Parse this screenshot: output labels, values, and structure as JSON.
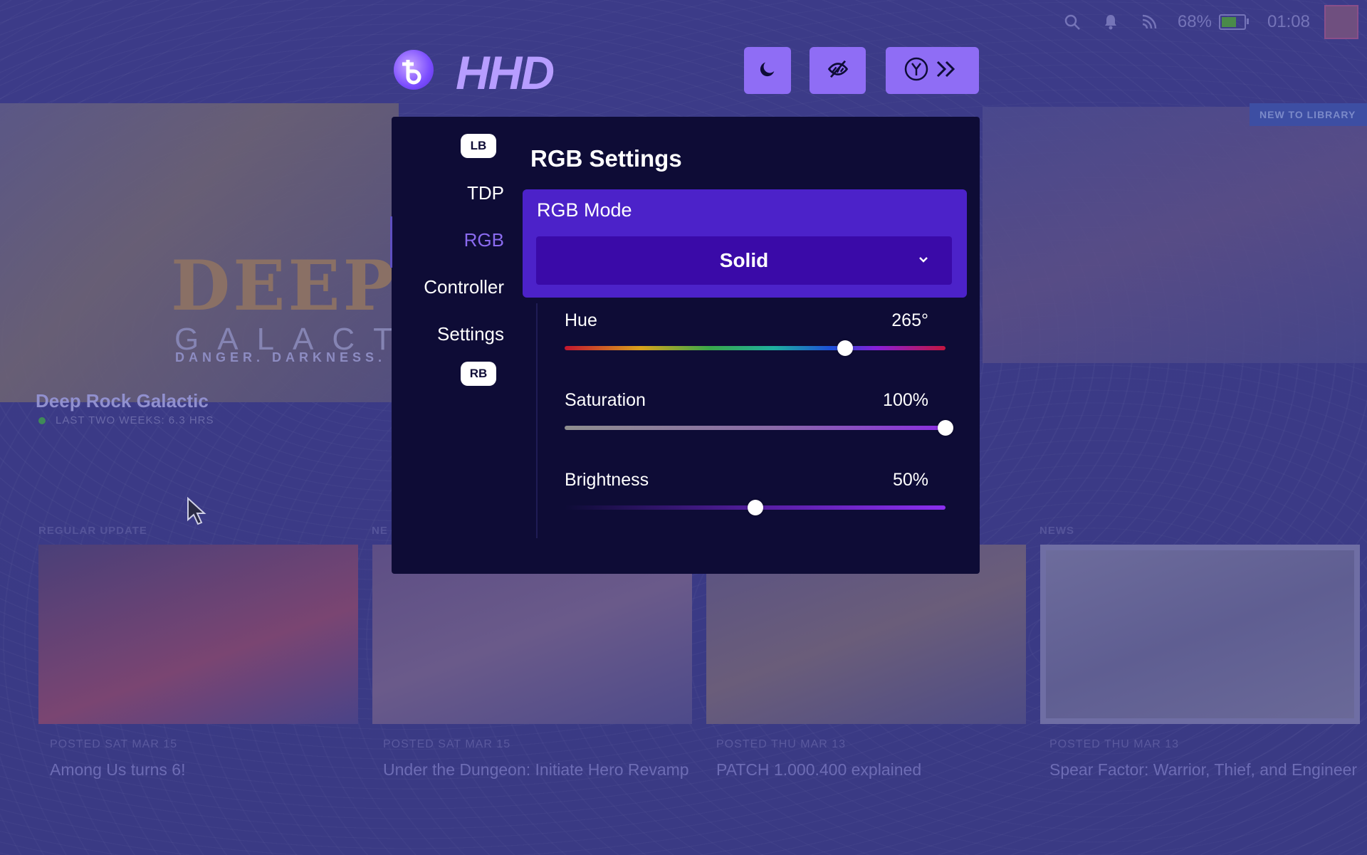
{
  "status_bar": {
    "battery_percent": "68%",
    "battery_level": 0.68,
    "time": "01:08",
    "icons": [
      "search-icon",
      "bell-icon",
      "wifi-icon",
      "battery-icon"
    ]
  },
  "top_bar": {
    "logo_text": "HHD",
    "buttons": [
      "moon-icon",
      "eye-off-icon",
      "y-button-skip-icon"
    ]
  },
  "background": {
    "new_to_library": "NEW TO LIBRARY",
    "featured": {
      "title_art": "DEEP RO",
      "subtitle_art": "GALACTIC",
      "tagline": "DANGER. DARKNESS.",
      "name": "Deep Rock Galactic",
      "meta": "LAST TWO WEEKS: 6.3 HRS"
    },
    "cards": [
      {
        "section": "REGULAR UPDATE",
        "date": "POSTED SAT MAR 15",
        "title": "Among Us turns 6!",
        "color": "#6a4a7a"
      },
      {
        "section": "NE",
        "date": "POSTED SAT MAR 15",
        "title": "Under the Dungeon: Initiate Hero Revamp",
        "color": "#5a4c86"
      },
      {
        "section": "",
        "date": "POSTED THU MAR 13",
        "title": "PATCH 1.000.400 explained",
        "color": "#574f82"
      },
      {
        "section": "NEWS",
        "date": "POSTED THU MAR 13",
        "title": "Spear Factor: Warrior, Thief, and Engineer",
        "color": "#6a6996"
      }
    ]
  },
  "panel": {
    "nav": {
      "lb_badge": "LB",
      "rb_badge": "RB",
      "items": [
        "TDP",
        "RGB",
        "Controller",
        "Settings"
      ],
      "active": "RGB"
    },
    "title": "RGB Settings",
    "mode": {
      "label": "RGB Mode",
      "selected": "Solid"
    },
    "sliders": {
      "hue": {
        "label": "Hue",
        "display": "265°",
        "value": 265,
        "max": 360
      },
      "saturation": {
        "label": "Saturation",
        "display": "100%",
        "value": 100,
        "max": 100
      },
      "brightness": {
        "label": "Brightness",
        "display": "50%",
        "value": 50,
        "max": 100
      }
    }
  },
  "colors": {
    "accent": "#8f6df5",
    "panel_bg": "#0e0c36",
    "mode_box": "#4c22c9",
    "select_bg": "#3a0aa8",
    "active_nav": "#8b6bf0"
  }
}
